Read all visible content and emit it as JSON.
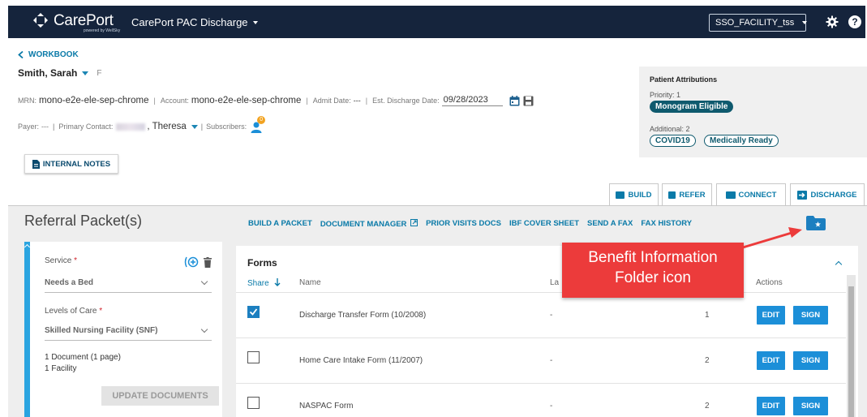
{
  "topbar": {
    "logo_text": "CarePort",
    "logo_sub": "powered by WellSky",
    "app_name": "CarePort PAC Discharge",
    "facility": "SSO_FACILITY_tss",
    "help_label": "?"
  },
  "patient": {
    "back_link": "WORKBOOK",
    "name": "Smith, Sarah",
    "sex": "F",
    "mrn_label": "MRN:",
    "mrn": "mono-e2e-ele-sep-chrome",
    "account_label": "Account:",
    "account": "mono-e2e-ele-sep-chrome",
    "admit_label": "Admit Date:",
    "admit": "---",
    "est_discharge_label": "Est. Discharge Date:",
    "est_discharge": "09/28/2023",
    "payer_label": "Payer:",
    "payer": "---",
    "primary_contact_label": "Primary Contact:",
    "primary_contact": "Theresa",
    "subscribers_label": "Subscribers:",
    "subscribers_count": "0",
    "internal_notes": "INTERNAL NOTES"
  },
  "attributions": {
    "title": "Patient Attributions",
    "priority_label": "Priority: 1",
    "priority_tag": "Monogram Eligible",
    "additional_label": "Additional: 2",
    "tags": [
      "COVID19",
      "Medically Ready"
    ]
  },
  "tabs": [
    "BUILD",
    "REFER",
    "CONNECT",
    "DISCHARGE"
  ],
  "referral": {
    "title": "Referral Packet(s)",
    "toolbar": [
      "BUILD A PACKET",
      "DOCUMENT MANAGER",
      "PRIOR VISITS DOCS",
      "IBF COVER SHEET",
      "SEND A FAX",
      "FAX HISTORY"
    ],
    "service_label": "Service",
    "service_value": "Needs a Bed",
    "levels_label": "Levels of Care",
    "levels_value": "Skilled Nursing Facility (SNF)",
    "documents_count": "1 Document (1 page)",
    "facility_count": "1 Facility",
    "update_button": "UPDATE DOCUMENTS",
    "required_mark": "*"
  },
  "forms": {
    "title": "Forms",
    "headers": {
      "share": "Share",
      "name": "Name",
      "last": "La",
      "actions": "Actions"
    },
    "rows": [
      {
        "name": "Discharge Transfer Form (10/2008)",
        "last": "-",
        "count": "1",
        "checked": true
      },
      {
        "name": "Home Care Intake Form (11/2007)",
        "last": "-",
        "count": "2",
        "checked": false
      },
      {
        "name": "NASPAC Form",
        "last": "-",
        "count": "2",
        "checked": false
      }
    ],
    "edit_label": "EDIT",
    "sign_label": "SIGN"
  },
  "callout": {
    "line1": "Benefit Information",
    "line2": "Folder icon"
  },
  "colors": {
    "nav": "#15243c",
    "accent": "#0a7aa8",
    "button": "#1c8fd8",
    "callout": "#ec3b3b",
    "rail": "#2aa4e0"
  }
}
